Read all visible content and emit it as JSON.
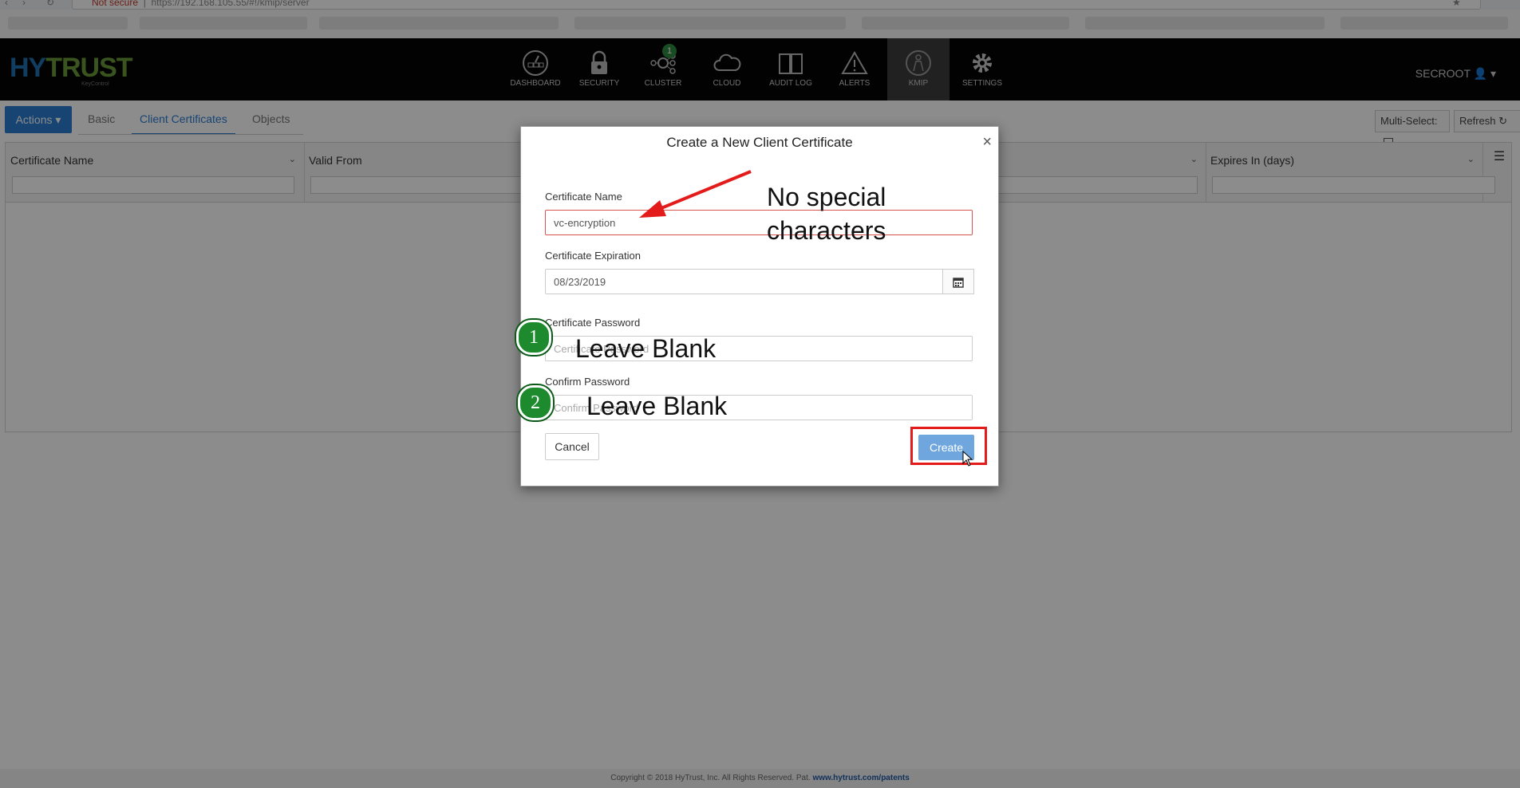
{
  "browser": {
    "security_label": "Not secure",
    "url": "https://192.168.105.55/#!/kmip/server"
  },
  "header": {
    "logo_text_a": "HY",
    "logo_text_b": "TRUST",
    "logo_sub": "KeyControl",
    "nav": [
      {
        "label": "DASHBOARD",
        "icon": "dashboard-icon"
      },
      {
        "label": "SECURITY",
        "icon": "lock-icon"
      },
      {
        "label": "CLUSTER",
        "icon": "cluster-icon",
        "badge": "1"
      },
      {
        "label": "CLOUD",
        "icon": "cloud-icon"
      },
      {
        "label": "AUDIT LOG",
        "icon": "book-icon"
      },
      {
        "label": "ALERTS",
        "icon": "warning-icon"
      },
      {
        "label": "KMIP",
        "icon": "kmip-icon",
        "active": true
      },
      {
        "label": "SETTINGS",
        "icon": "gear-icon"
      }
    ],
    "user": "SECROOT"
  },
  "toolbar": {
    "actions_label": "Actions",
    "tabs": [
      "Basic",
      "Client Certificates",
      "Objects"
    ],
    "multiselect_label": "Multi-Select:",
    "refresh_label": "Refresh"
  },
  "grid": {
    "columns": [
      "Certificate Name",
      "Valid From",
      "",
      "Expires In (days)"
    ]
  },
  "modal": {
    "title": "Create a New Client Certificate",
    "name_label": "Certificate Name",
    "name_value": "vc-encryption",
    "expiration_label": "Certificate Expiration",
    "expiration_value": "08/23/2019",
    "password_label": "Certificate Password",
    "password_placeholder": "Certificate Password",
    "confirm_label": "Confirm Password",
    "confirm_placeholder": "Confirm Password",
    "cancel_label": "Cancel",
    "create_label": "Create"
  },
  "annotations": {
    "note_line1": "No special",
    "note_line2": "characters",
    "step1_num": "1",
    "step1_text": "Leave Blank",
    "step2_num": "2",
    "step2_text": "Leave Blank"
  },
  "footer": {
    "text": "Copyright © 2018 HyTrust, Inc. All Rights Reserved. Pat.",
    "link": "www.hytrust.com/patents"
  },
  "colors": {
    "accent": "#2a7dd1",
    "header_bg": "#050505",
    "annotation_red": "#e31b1b",
    "annotation_green": "#1e8a2e"
  }
}
